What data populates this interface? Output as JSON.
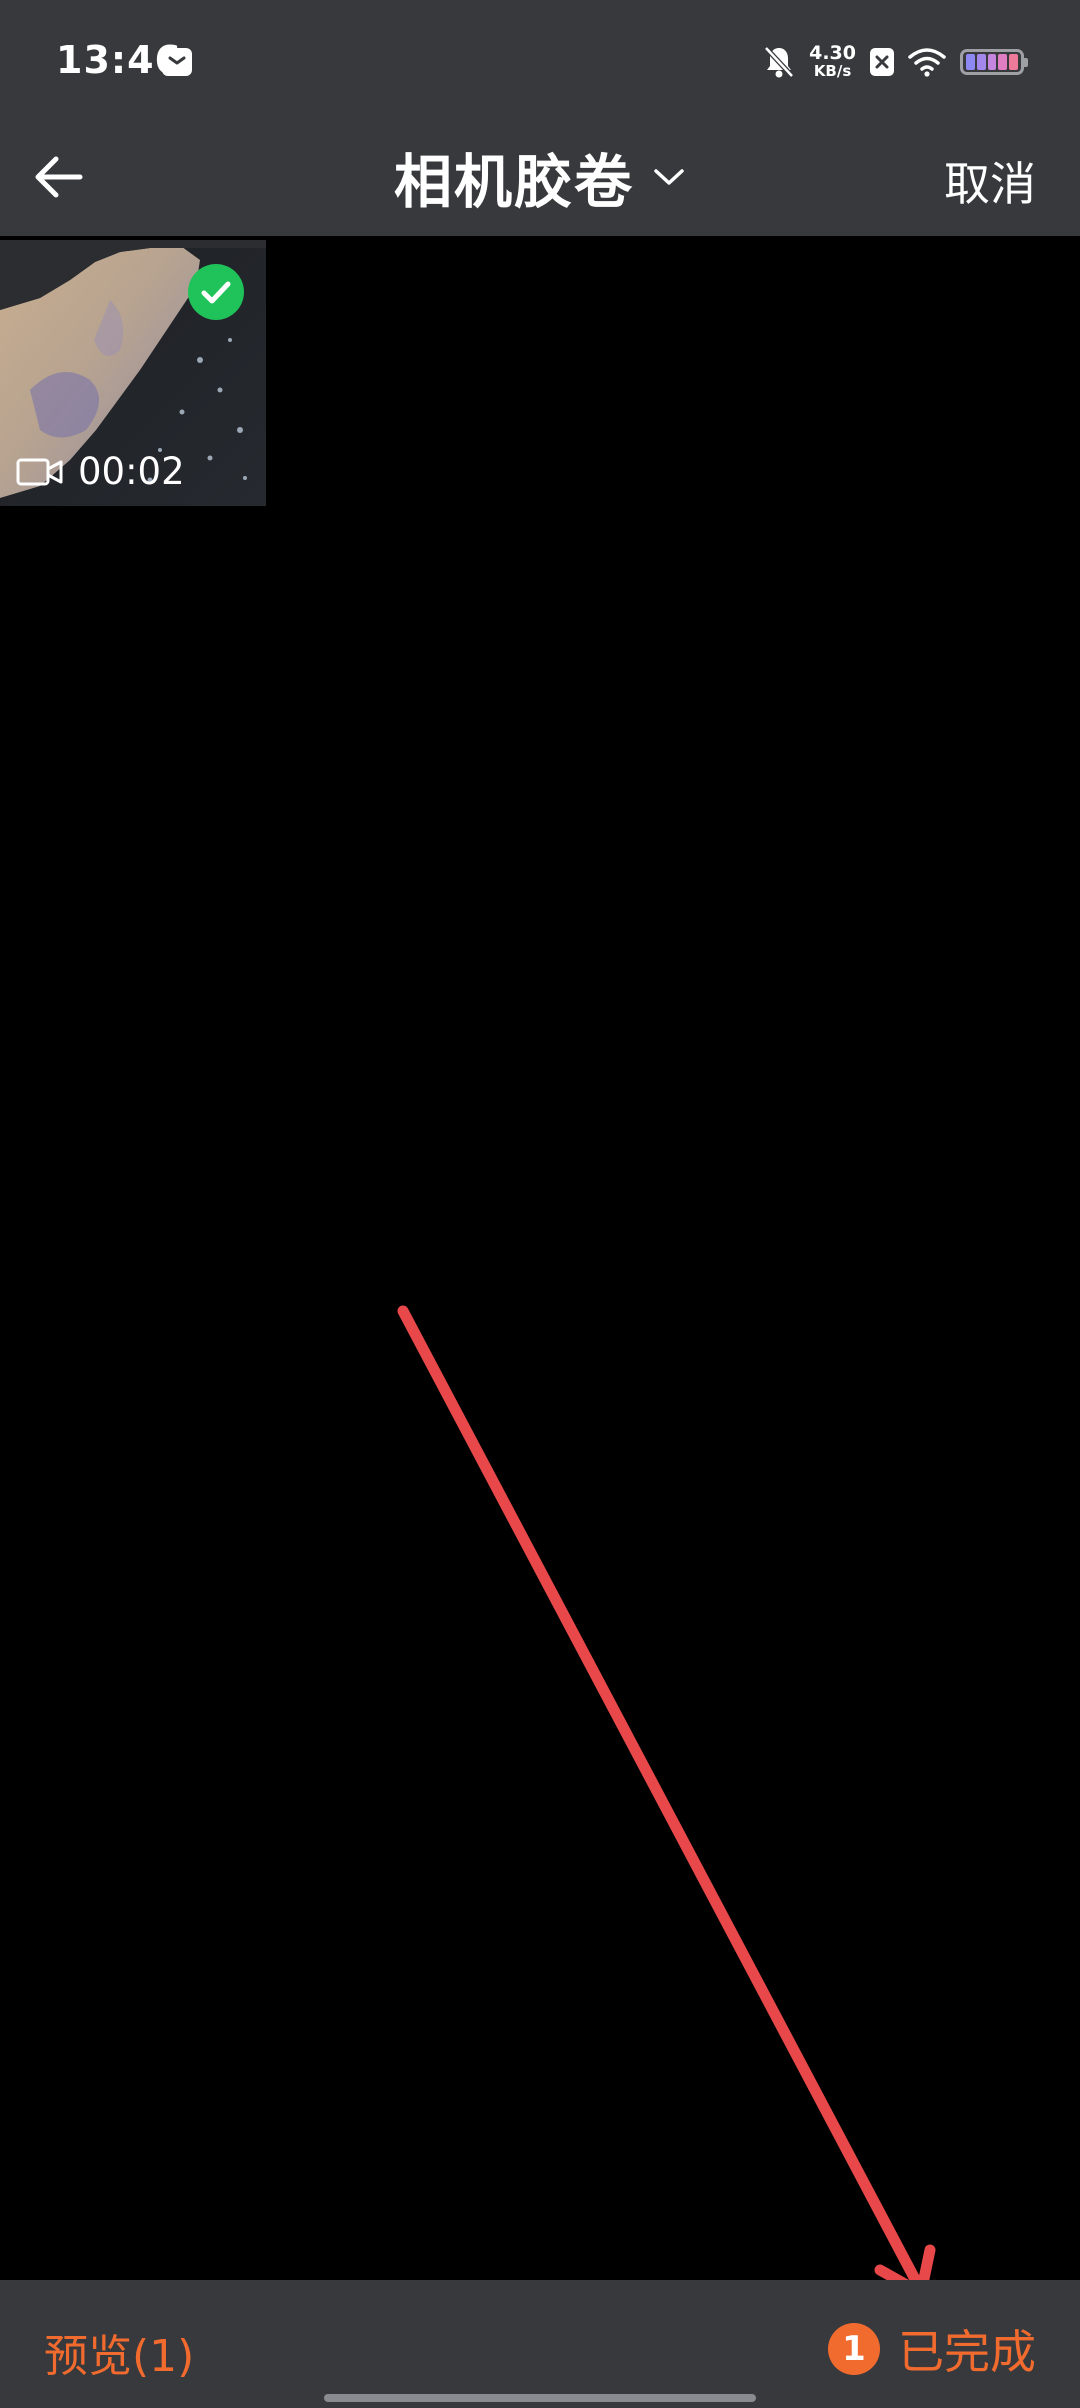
{
  "status_bar": {
    "time": "13:46",
    "network_speed_value": "4.30",
    "network_speed_unit": "KB/s",
    "icons": [
      "message-icon",
      "bell-off-icon",
      "x-icon",
      "wifi-icon",
      "battery-icon"
    ]
  },
  "nav": {
    "back_icon": "arrow-left-icon",
    "title": "相机胶卷",
    "dropdown_icon": "chevron-down-icon",
    "cancel_label": "取消"
  },
  "media": {
    "items": [
      {
        "duration": "00:02",
        "selected": true,
        "type_icon": "video-camera-icon"
      }
    ]
  },
  "bottom_bar": {
    "preview_label": "预览(1)",
    "selected_count": "1",
    "done_label": "已完成"
  },
  "colors": {
    "bar_bg": "#38393d",
    "accent_orange": "#f26b2e",
    "check_green": "#1fc35a",
    "annotation_red": "#e9484a"
  }
}
